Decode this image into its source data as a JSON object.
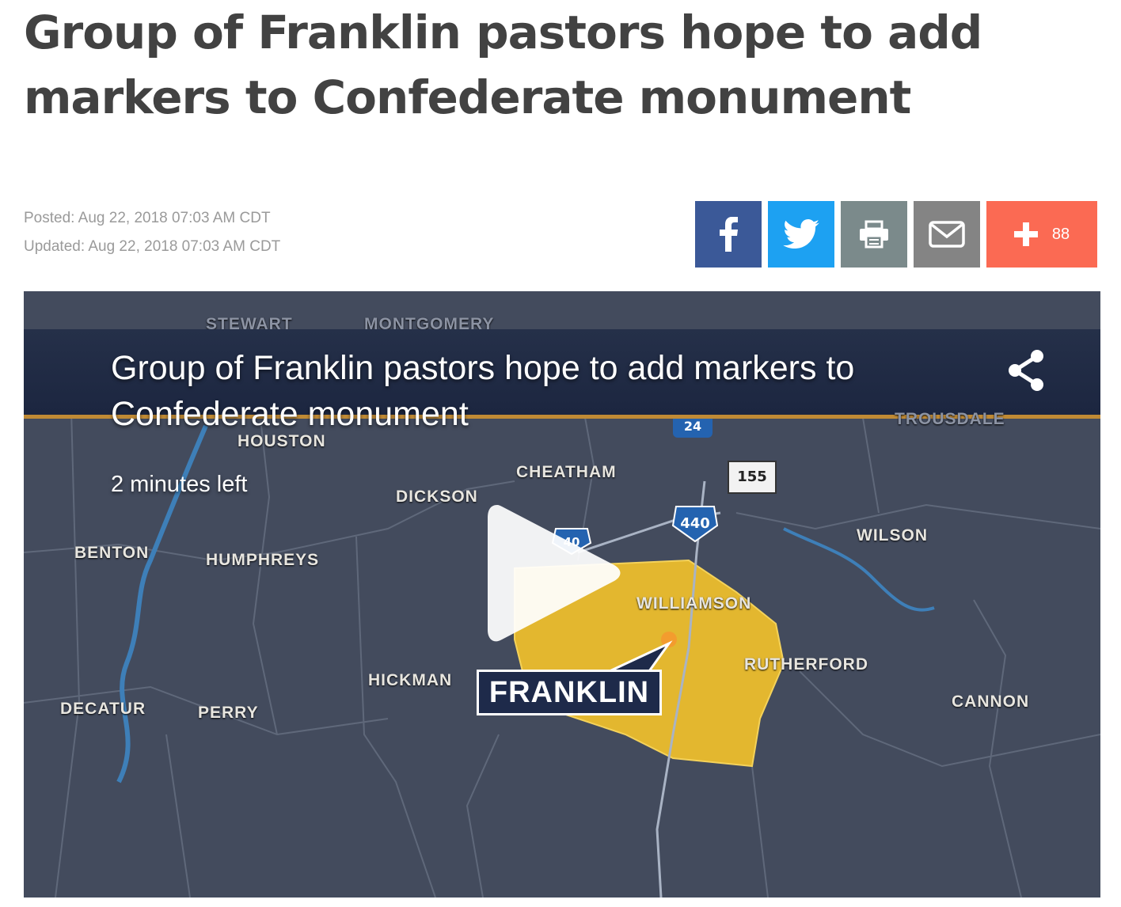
{
  "article": {
    "headline": "Group of Franklin pastors hope to add markers to Confederate monument",
    "posted": "Posted: Aug 22, 2018 07:03 AM CDT",
    "updated": "Updated: Aug 22, 2018 07:03 AM CDT"
  },
  "share": {
    "buttons": [
      {
        "name": "facebook",
        "icon": "facebook-icon",
        "color": "#3b5998"
      },
      {
        "name": "twitter",
        "icon": "twitter-icon",
        "color": "#1da1f2"
      },
      {
        "name": "print",
        "icon": "print-icon",
        "color": "#7b8a8b"
      },
      {
        "name": "email",
        "icon": "envelope-icon",
        "color": "#848484"
      },
      {
        "name": "more",
        "icon": "plus-icon",
        "color": "#fb6a53"
      }
    ],
    "count": "88"
  },
  "video": {
    "title": "Group of Franklin pastors hope to add markers to Confederate monument",
    "time_left": "2 minutes left",
    "map": {
      "counties": [
        "STEWART",
        "MONTGOMERY",
        "HOUSTON",
        "CHEATHAM",
        "DICKSON",
        "WILSON",
        "BENTON",
        "HUMPHREYS",
        "WILLIAMSON",
        "RUTHERFORD",
        "HICKMAN",
        "DECATUR",
        "PERRY",
        "CANNON",
        "TROUSDALE"
      ],
      "highlight": "FRANKLIN",
      "highway_shields": [
        "24",
        "40",
        "440",
        "155"
      ]
    }
  }
}
